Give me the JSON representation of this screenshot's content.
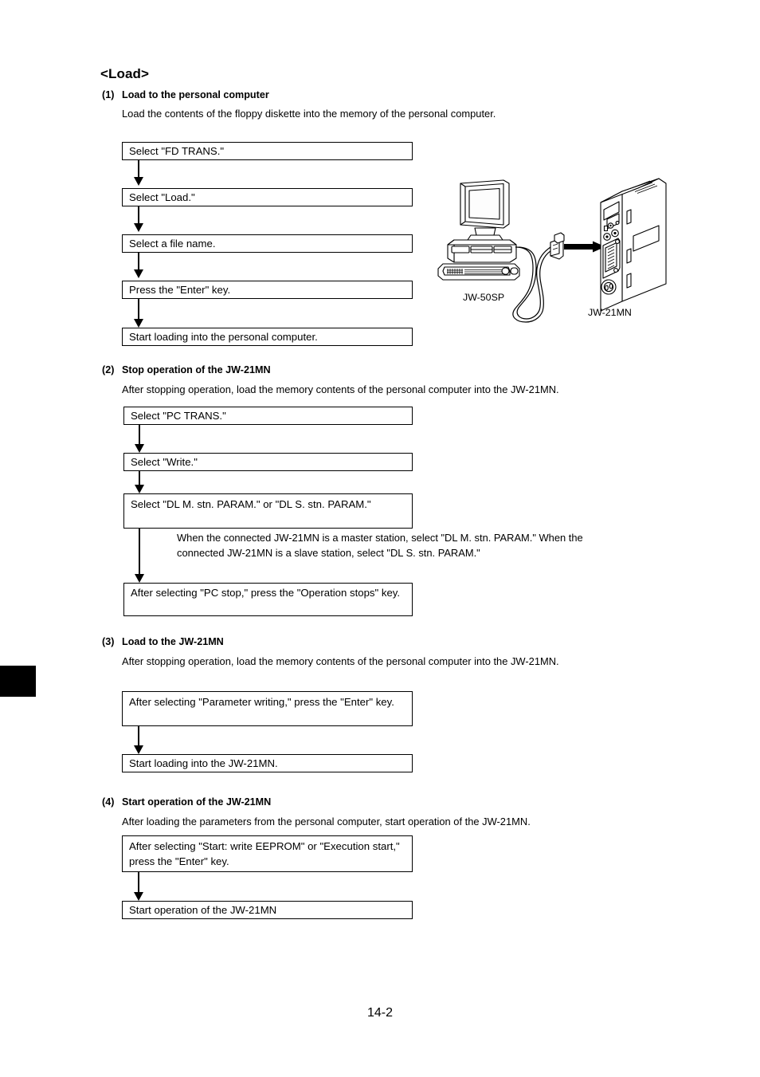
{
  "page": {
    "title": "<Load>",
    "page_number": "14-2"
  },
  "sections": [
    {
      "number": "(1)",
      "heading": "Load to the personal computer",
      "body": "Load the contents of the floppy diskette into the memory of the personal computer.",
      "steps": [
        "Select \"FD TRANS.\"",
        "Select \"Load.\"",
        "Select a file name.",
        "Press the \"Enter\" key.",
        "Start loading into the personal computer."
      ]
    },
    {
      "number": "(2)",
      "heading": "Stop operation of the JW-21MN",
      "body": "After stopping operation, load the memory contents of the personal computer into the JW-21MN.",
      "steps": [
        "Select \"PC TRANS.\"",
        "Select \"Write.\"",
        "Select \"DL M. stn. PARAM.\" or \"DL S. stn. PARAM.\"",
        "After selecting \"PC stop,\" press the \"Operation stops\" key."
      ],
      "note": "When the connected JW-21MN is a master station, select \"DL M. stn. PARAM.\" When the connected JW-21MN is a slave station, select \"DL S. stn. PARAM.\""
    },
    {
      "number": "(3)",
      "heading": "Load to the JW-21MN",
      "body": "After stopping operation, load the memory contents of the personal computer into the JW-21MN.",
      "steps": [
        "After selecting \"Parameter writing,\" press the \"Enter\" key.",
        "Start loading into the JW-21MN."
      ]
    },
    {
      "number": "(4)",
      "heading": "Start operation of the JW-21MN",
      "body": "After loading the parameters from the personal computer, start operation of the JW-21MN.",
      "steps": [
        "After selecting \"Start: write EEPROM\" or \"Execution start,\" press the \"Enter\" key.",
        "Start operation of the JW-21MN"
      ]
    }
  ],
  "figure": {
    "computer_label": "JW-50SP",
    "module_label": "JW-21MN"
  }
}
